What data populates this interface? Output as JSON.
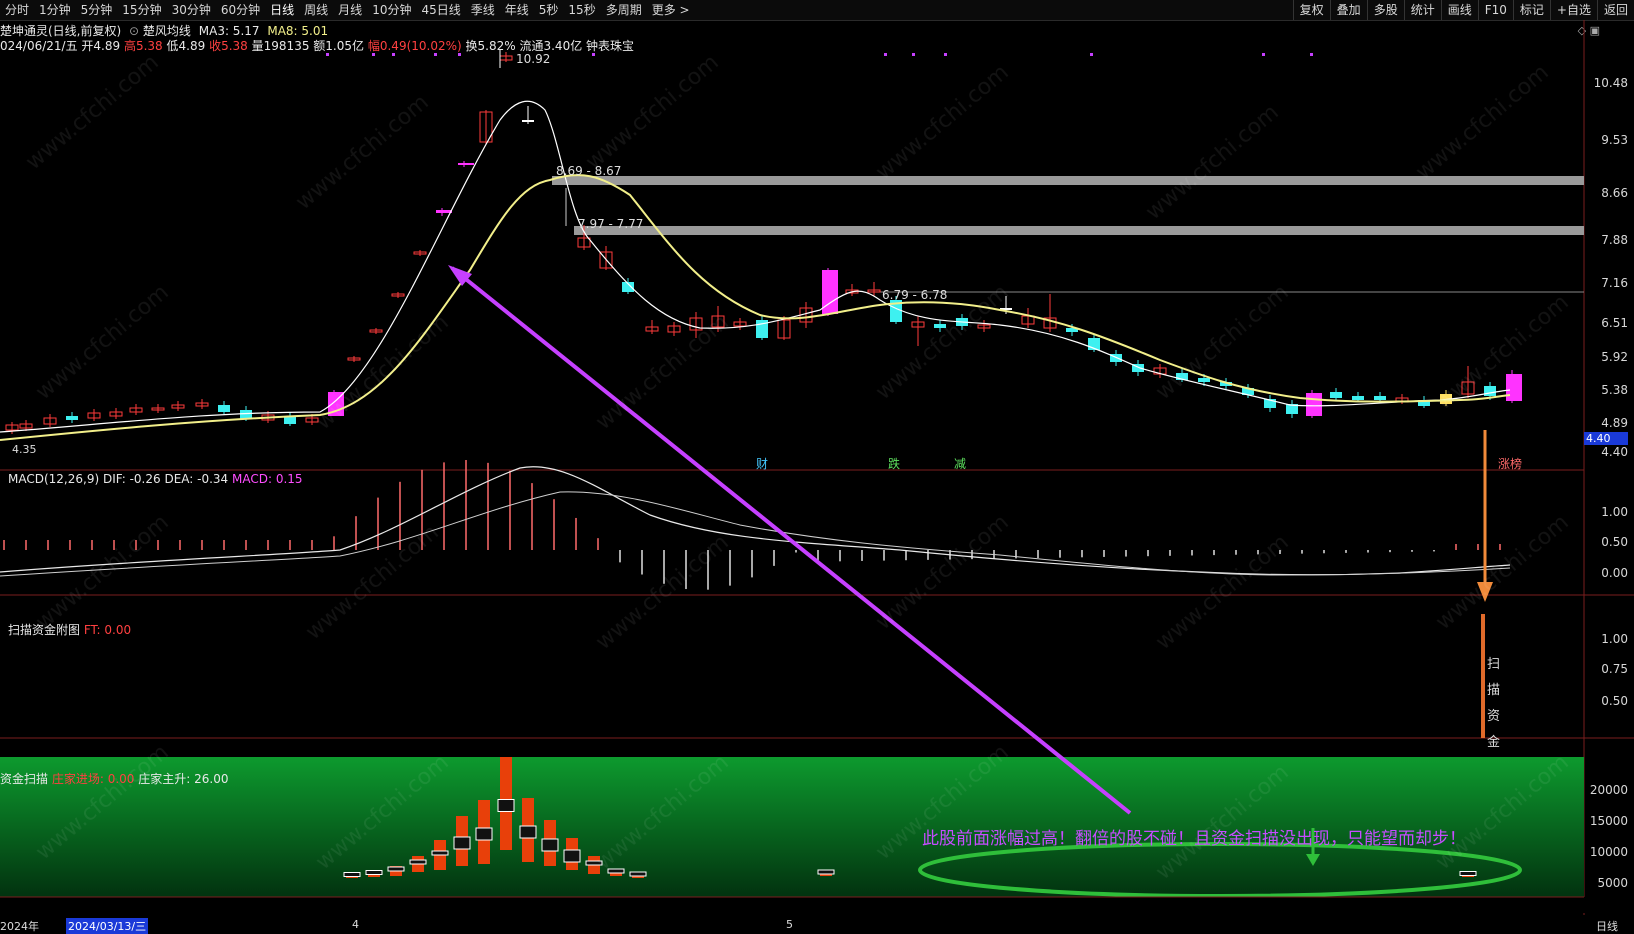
{
  "toolbar": {
    "tabs": [
      "分时",
      "1分钟",
      "5分钟",
      "15分钟",
      "30分钟",
      "60分钟",
      "日线",
      "周线",
      "月线",
      "10分钟",
      "45日线",
      "季线",
      "年线",
      "5秒",
      "15秒",
      "多周期",
      "更多 >"
    ],
    "tools": [
      "复权",
      "叠加",
      "多股",
      "统计",
      "画线",
      "F10",
      "标记",
      "+自选",
      "返回"
    ]
  },
  "main": {
    "title": "楚坤通灵(日线,前复权)",
    "indicator": "楚风均线",
    "ma3": "MA3: 5.17",
    "ma8": "MA8: 5.01",
    "info_date": "024/06/21/五",
    "open": "开4.89",
    "high": "高5.38",
    "low": "低4.89",
    "close": "收5.38",
    "volume": "量198135",
    "amount": "额1.05亿",
    "range": "幅0.49(10.02%)",
    "turnover": "换5.82%",
    "float": "流通3.40亿",
    "tool": "钟表珠宝",
    "peak_label": "10.92",
    "low_label": "4.35",
    "zone1": "8.69 - 8.67",
    "zone2": "7.97 - 7.77",
    "zone3": "6.79 - 6.78",
    "price_tag": "4.40",
    "marks": [
      "财",
      "跌",
      "减"
    ],
    "zhangting": "涨榜",
    "y_labels": [
      "10.48",
      "9.53",
      "8.66",
      "7.88",
      "7.16",
      "6.51",
      "5.92",
      "5.38",
      "4.89",
      "4.40"
    ]
  },
  "macd": {
    "title": "MACD(12,26,9)",
    "dif": "DIF: -0.26",
    "dea": "DEA: -0.34",
    "macd": "MACD: 0.15",
    "y_labels": [
      "1.00",
      "0.50",
      "0.00"
    ]
  },
  "scan": {
    "title": "扫描资金附图",
    "ft": "FT: 0.00",
    "y_labels": [
      "1.00",
      "0.75",
      "0.50"
    ],
    "vertical_text": [
      "扫",
      "描",
      "资",
      "金"
    ]
  },
  "fund": {
    "title": "资金扫描",
    "enter": "庄家进场: 0.00",
    "rise": "庄家主升: 26.00",
    "y_labels": [
      "20000",
      "15000",
      "10000",
      "5000"
    ],
    "annotation": "此股前面涨幅过高！翻倍的股不碰！且资金扫描没出现，只能望而却步！"
  },
  "xaxis": {
    "year": "2024年",
    "date_box": "2024/03/13/三",
    "m4": "4",
    "m5": "5",
    "period": "日线"
  },
  "watermark": "www.cfchi.com",
  "colors": {
    "up": "#ff3b3b",
    "down": "#3ef0f0",
    "limit": "#ff33ff",
    "ma_fast": "#ffffff",
    "ma_slow": "#f2ef8a",
    "green_panel": "#0a8a2a",
    "arrow_purple": "#c640ff",
    "arrow_orange": "#f08a3a"
  }
}
